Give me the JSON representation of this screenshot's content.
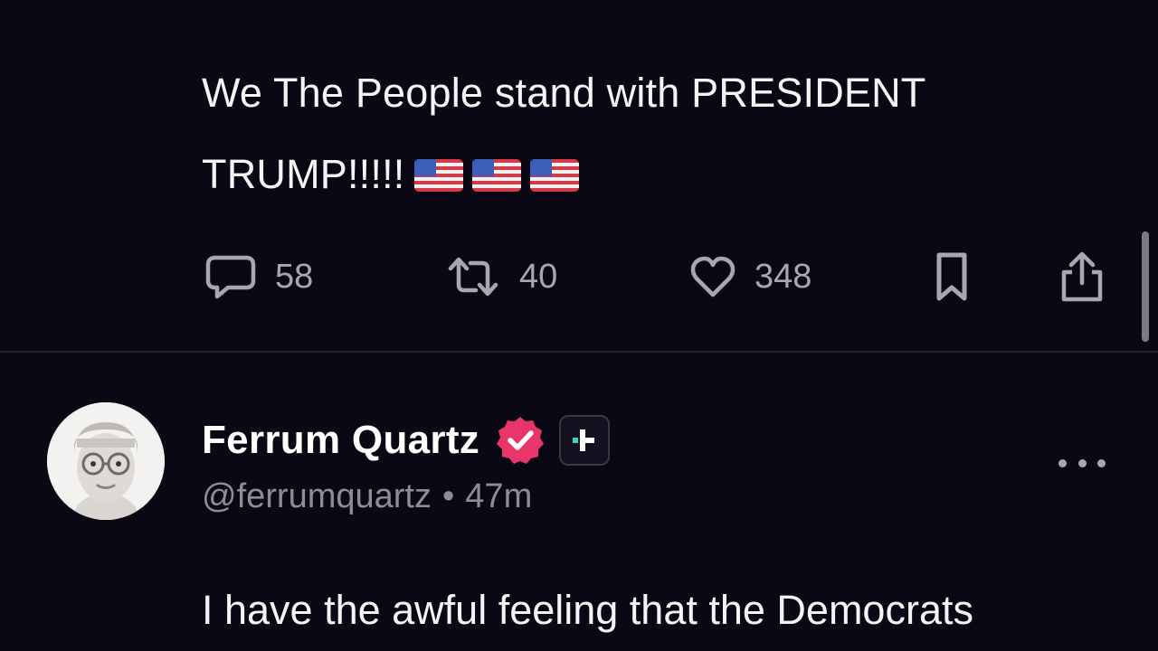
{
  "post1": {
    "text": "We The People stand with PRESIDENT TRUMP!!!!!",
    "flags": [
      "🇺🇸",
      "🇺🇸",
      "🇺🇸"
    ],
    "actions": {
      "replies": "58",
      "reposts": "40",
      "likes": "348"
    }
  },
  "post2": {
    "author_name": "Ferrum Quartz",
    "handle": "@ferrumquartz",
    "separator": "•",
    "time": "47m",
    "text": "I have the awful feeling that the Democrats"
  },
  "colors": {
    "background": "#0b0815",
    "text": "#f4f4f4",
    "muted": "#a7a7b0",
    "verified_badge": "#e8366b"
  },
  "icons": {
    "reply": "reply-icon",
    "repost": "repost-icon",
    "like": "heart-icon",
    "bookmark": "bookmark-icon",
    "share": "share-icon",
    "verified": "verified-badge-icon",
    "plus": "plus-badge-icon",
    "more": "more-options-icon"
  }
}
